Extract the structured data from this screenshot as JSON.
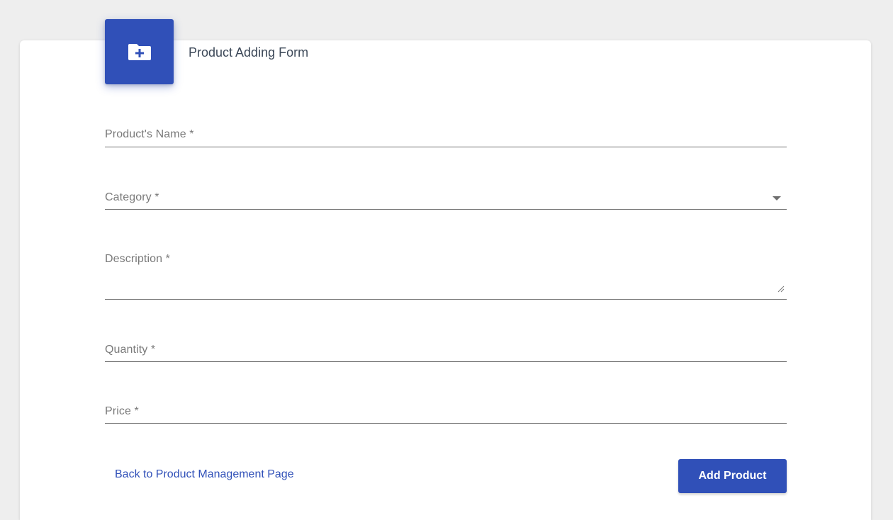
{
  "header": {
    "title": "Product Adding Form",
    "icon": "folder-plus-icon",
    "accent_color": "#3050b8"
  },
  "form": {
    "fields": {
      "name": {
        "label": "Product's Name *",
        "value": ""
      },
      "category": {
        "label": "Category *",
        "value": "",
        "icon": "dropdown-arrow-icon"
      },
      "description": {
        "label": "Description *",
        "value": ""
      },
      "quantity": {
        "label": "Quantity *",
        "value": ""
      },
      "price": {
        "label": "Price *",
        "value": ""
      }
    }
  },
  "actions": {
    "back_link": "Back to Product Management Page",
    "submit_label": "Add Product"
  }
}
